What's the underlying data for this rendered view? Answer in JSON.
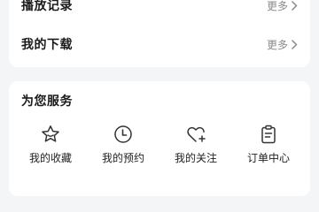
{
  "top_card": {
    "rows": [
      {
        "label": "播放记录",
        "more": "更多"
      },
      {
        "label": "我的下载",
        "more": "更多"
      }
    ]
  },
  "services": {
    "title": "为您服务",
    "items": [
      {
        "label": "我的收藏",
        "icon": "star-icon"
      },
      {
        "label": "我的预约",
        "icon": "clock-icon"
      },
      {
        "label": "我的关注",
        "icon": "heart-plus-icon"
      },
      {
        "label": "订单中心",
        "icon": "clipboard-icon"
      }
    ]
  },
  "colors": {
    "background": "#f4f5f7",
    "card": "#ffffff",
    "muted_text": "#8a8a8a"
  }
}
